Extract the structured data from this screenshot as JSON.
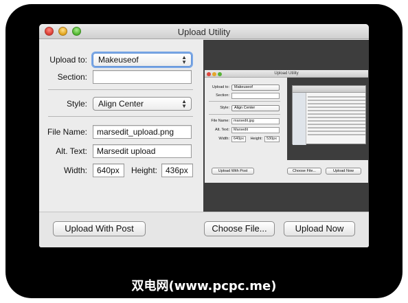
{
  "window": {
    "title": "Upload Utility"
  },
  "form": {
    "upload_to_label": "Upload to:",
    "upload_to_value": "Makeuseof",
    "section_label": "Section:",
    "section_value": "",
    "style_label": "Style:",
    "style_value": "Align Center",
    "file_name_label": "File Name:",
    "file_name_value": "marsedit_upload.png",
    "alt_text_label": "Alt. Text:",
    "alt_text_value": "Marsedit upload",
    "width_label": "Width:",
    "width_value": "640px",
    "height_label": "Height:",
    "height_value": "436px"
  },
  "buttons": {
    "upload_with_post": "Upload With Post",
    "choose_file": "Choose File...",
    "upload_now": "Upload Now"
  },
  "preview_image": {
    "title": "Upload Utility",
    "upload_to_label": "Upload to:",
    "upload_to_value": "Makeuseof",
    "section_label": "Section:",
    "style_label": "Style:",
    "style_value": "Align Center",
    "file_name_label": "File Name:",
    "file_name_value": "marsedit.jpg",
    "alt_text_label": "Alt. Text:",
    "alt_text_value": "Marsedit",
    "width_label": "Width:",
    "width_value": "640px",
    "height_label": "Height:",
    "height_value": "530px",
    "upload_with_post": "Upload With Post",
    "choose_file": "Choose File...",
    "upload_now": "Upload Now"
  },
  "watermark": "双电网(www.pcpc.me)"
}
